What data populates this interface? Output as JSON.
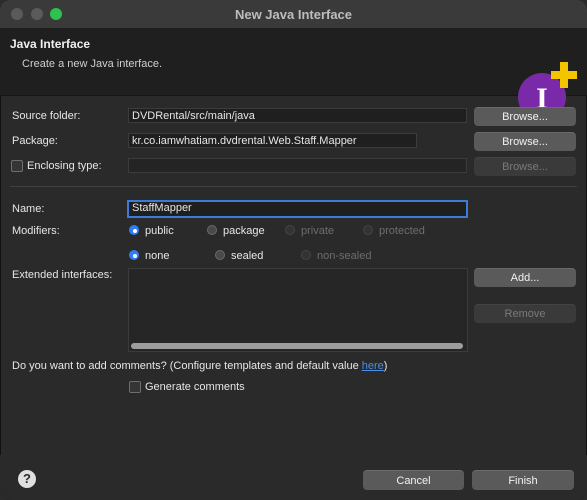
{
  "window": {
    "title": "New Java Interface"
  },
  "header": {
    "title": "Java Interface",
    "subtitle": "Create a new Java interface.",
    "logo_icon": "java-interface-plus-icon"
  },
  "form": {
    "source_folder": {
      "label": "Source folder:",
      "value": "DVDRental/src/main/java",
      "button": "Browse..."
    },
    "package": {
      "label": "Package:",
      "value": "kr.co.iamwhatiam.dvdrental.Web.Staff.Mapper",
      "button": "Browse..."
    },
    "enclosing_type": {
      "label": "Enclosing type:",
      "value": "",
      "button": "Browse...",
      "checked": false
    },
    "name": {
      "label": "Name:",
      "value": "StaffMapper"
    },
    "modifiers": {
      "label": "Modifiers:",
      "access": [
        {
          "label": "public",
          "selected": true,
          "enabled": true
        },
        {
          "label": "package",
          "selected": false,
          "enabled": true
        },
        {
          "label": "private",
          "selected": false,
          "enabled": false
        },
        {
          "label": "protected",
          "selected": false,
          "enabled": false
        }
      ],
      "sealing": [
        {
          "label": "none",
          "selected": true,
          "enabled": true
        },
        {
          "label": "sealed",
          "selected": false,
          "enabled": true
        },
        {
          "label": "non-sealed",
          "selected": false,
          "enabled": false
        }
      ]
    },
    "extended_interfaces": {
      "label": "Extended interfaces:",
      "add": "Add...",
      "remove": "Remove"
    },
    "comments": {
      "question_prefix": "Do you want to add comments? (Configure templates and default value ",
      "link": "here",
      "question_suffix": ")",
      "checkbox_label": "Generate comments",
      "checked": false
    }
  },
  "footer": {
    "help": "?",
    "cancel": "Cancel",
    "finish": "Finish"
  },
  "colors": {
    "accent": "#2f7df6",
    "focus_border": "#3d7bd9",
    "link": "#4d8fe6",
    "plus": "#f5c400",
    "logo_circle": "#7a2aa8"
  }
}
